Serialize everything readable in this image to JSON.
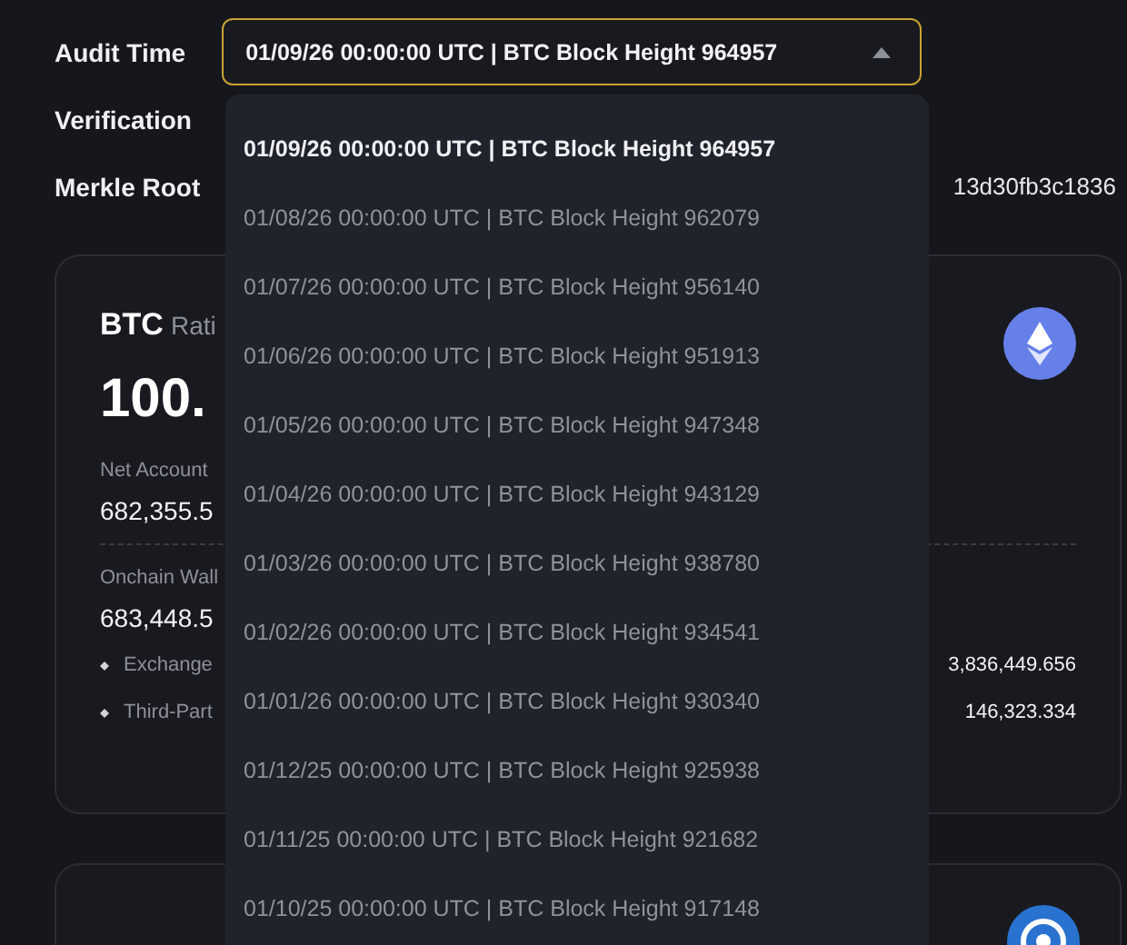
{
  "audit_time": {
    "label": "Audit Time",
    "value": "01/09/26 00:00:00 UTC | BTC Block Height 964957",
    "expanded": true
  },
  "dropdown_options": [
    {
      "label": "01/09/26 00:00:00 UTC | BTC Block Height 964957",
      "selected": true
    },
    {
      "label": "01/08/26 00:00:00 UTC | BTC Block Height 962079",
      "selected": false
    },
    {
      "label": "01/07/26 00:00:00 UTC | BTC Block Height 956140",
      "selected": false
    },
    {
      "label": "01/06/26 00:00:00 UTC | BTC Block Height 951913",
      "selected": false
    },
    {
      "label": "01/05/26 00:00:00 UTC | BTC Block Height 947348",
      "selected": false
    },
    {
      "label": "01/04/26 00:00:00 UTC | BTC Block Height 943129",
      "selected": false
    },
    {
      "label": "01/03/26 00:00:00 UTC | BTC Block Height 938780",
      "selected": false
    },
    {
      "label": "01/02/26 00:00:00 UTC | BTC Block Height 934541",
      "selected": false
    },
    {
      "label": "01/01/26 00:00:00 UTC | BTC Block Height 930340",
      "selected": false
    },
    {
      "label": "01/12/25 00:00:00 UTC | BTC Block Height 925938",
      "selected": false
    },
    {
      "label": "01/11/25 00:00:00 UTC | BTC Block Height 921682",
      "selected": false
    },
    {
      "label": "01/10/25 00:00:00 UTC | BTC Block Height 917148",
      "selected": false
    }
  ],
  "verification": {
    "label": "Verification"
  },
  "merkle_root": {
    "label": "Merkle Root",
    "value": "13d30fb3c1836"
  },
  "card": {
    "asset": "BTC",
    "subtitle": "Rati",
    "ratio": "100.",
    "net_label": "Net Account",
    "net_value": "682,355.5",
    "onchain_label": "Onchain Wall",
    "onchain_value": "683,448.5",
    "items": [
      {
        "label": "Exchange",
        "value": "3,836,449.656"
      },
      {
        "label": "Third-Part",
        "value": "146,323.334"
      }
    ]
  }
}
